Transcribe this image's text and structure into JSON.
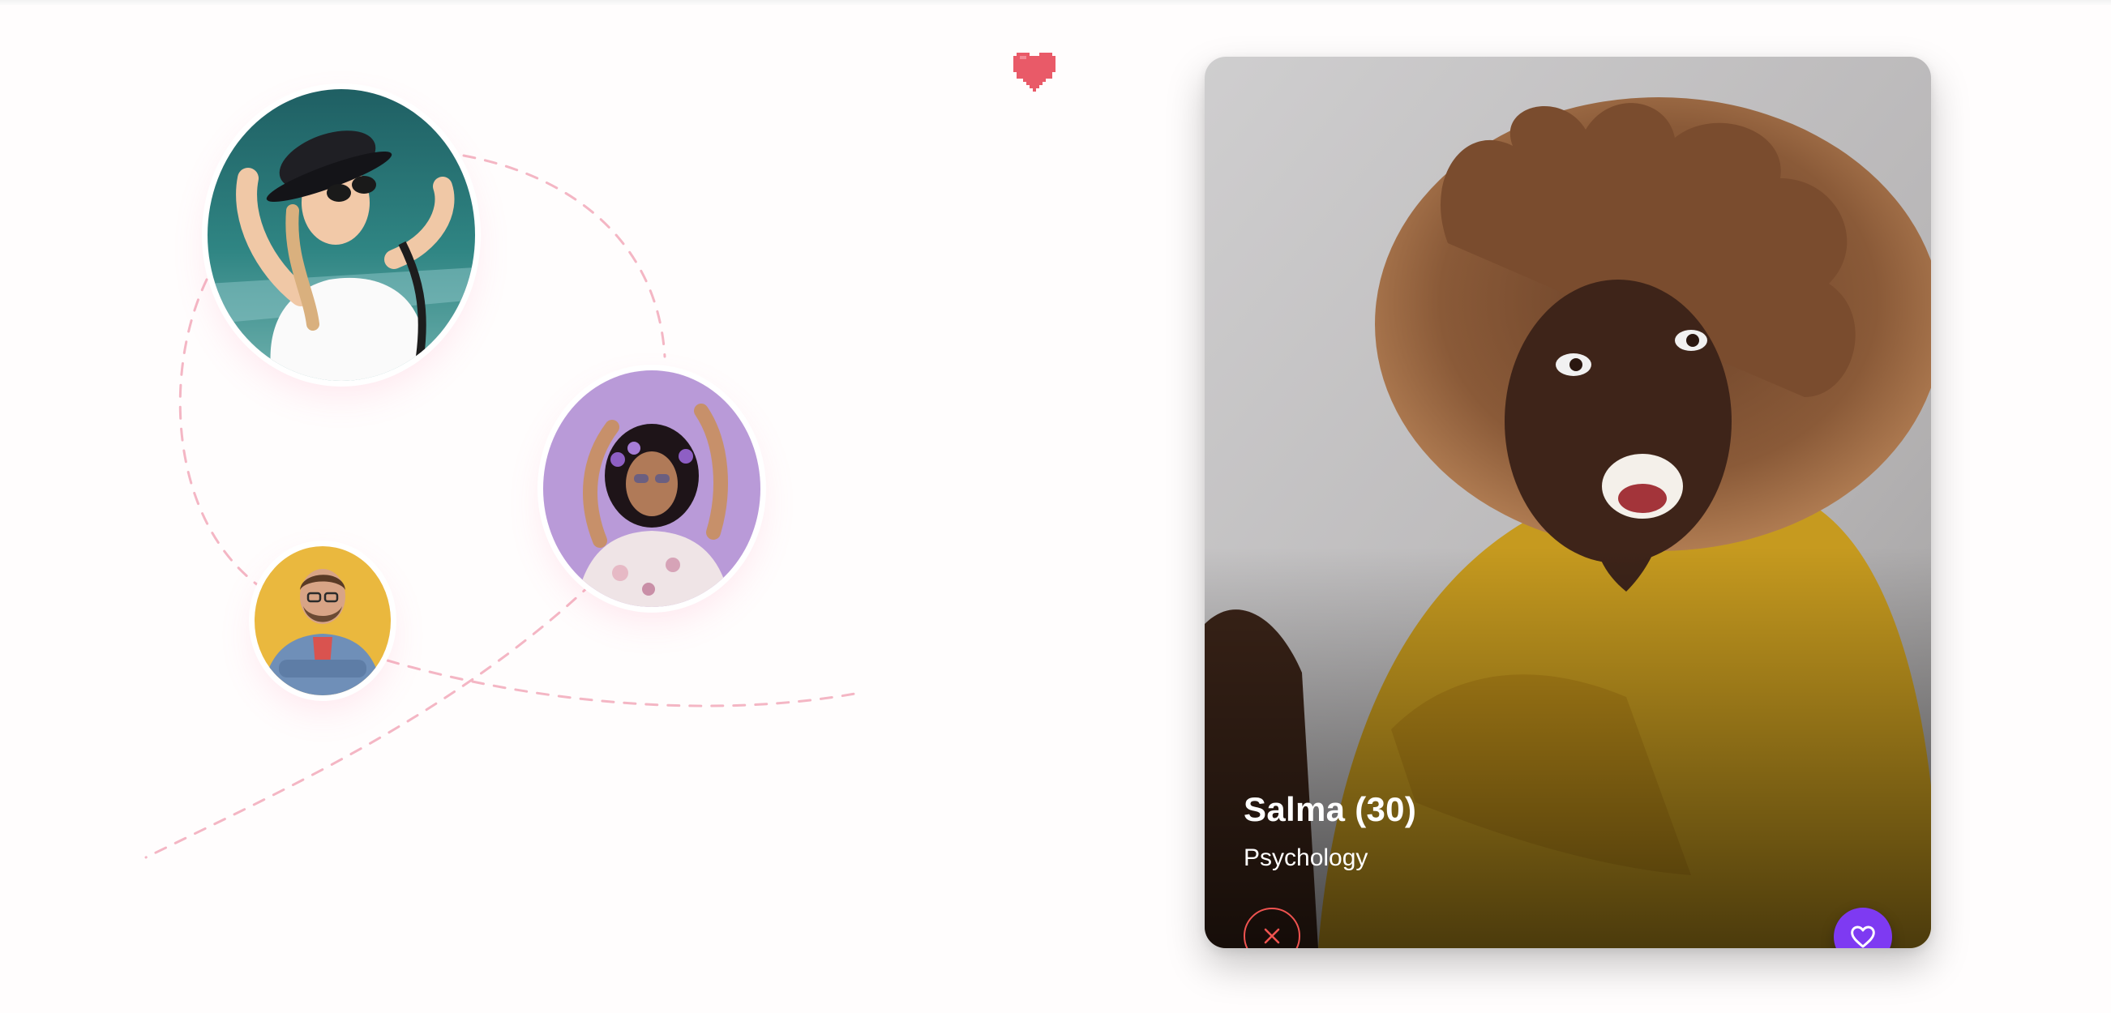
{
  "colors": {
    "accent_purple": "#7e3af2",
    "dislike_red": "#ef5350",
    "heart_pink": "#e95a68",
    "connector_pink": "#f4b6c4"
  },
  "decorations": {
    "floating_heart_icon": "heart-icon",
    "connector_lines": "dashed-curve"
  },
  "avatars": [
    {
      "id": "woman-sunglasses-hat",
      "background": "#2c7a78"
    },
    {
      "id": "woman-flower-crown",
      "background": "#b99ad8"
    },
    {
      "id": "man-denim-jacket",
      "background": "#eab83e"
    }
  ],
  "profile_card": {
    "name": "Salma (30)",
    "subtitle": "Psychology",
    "dislike_icon": "close-icon",
    "like_icon": "heart-icon"
  }
}
